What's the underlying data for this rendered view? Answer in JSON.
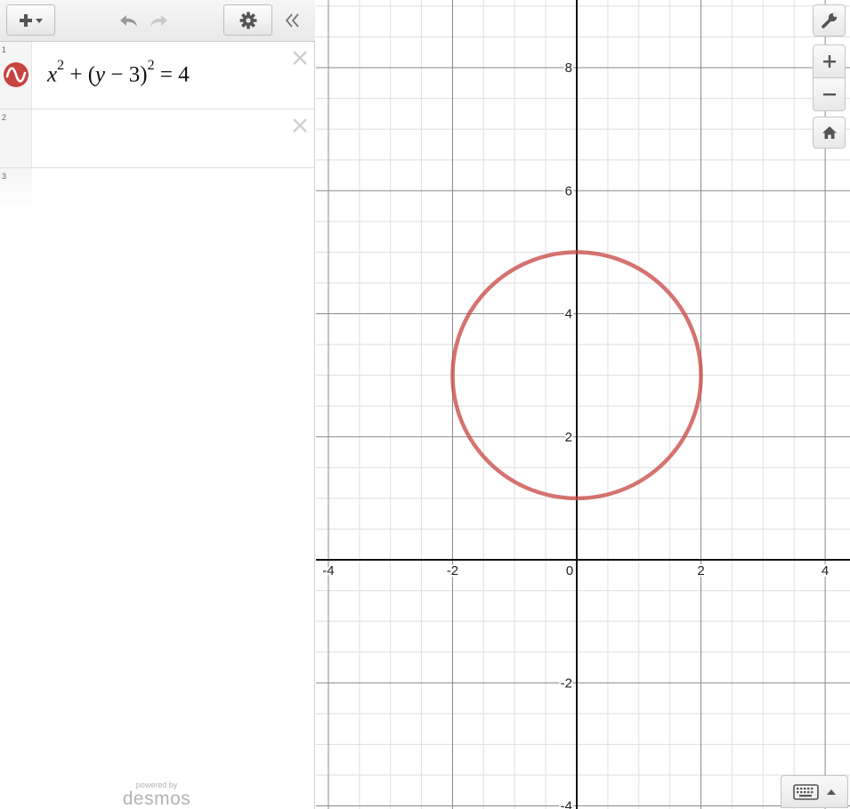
{
  "toolbar": {
    "add_icon": "plus-dropdown-icon",
    "undo_icon": "undo-icon",
    "redo_icon": "redo-icon",
    "settings_icon": "gear-icon",
    "collapse_icon": "double-chevron-left-icon"
  },
  "expressions": [
    {
      "number": "1",
      "latex": "x^2+(y-3)^2=4",
      "color": "#c74440",
      "icon": "graph-wave-icon"
    },
    {
      "number": "2",
      "latex": ""
    },
    {
      "number": "3",
      "latex": ""
    }
  ],
  "branding": {
    "powered_by": "powered by",
    "name": "desmos"
  },
  "graph": {
    "x_range": [
      -4.2,
      4.4
    ],
    "y_range": [
      -4.05,
      9.1
    ],
    "major_step": 2,
    "minor_step": 0.5,
    "grid": true,
    "x_tick_labels": [
      "-4",
      "-2",
      "0",
      "2",
      "4"
    ],
    "y_tick_labels": [
      "8",
      "6",
      "4",
      "2",
      "-2",
      "-4"
    ],
    "curve": {
      "type": "circle",
      "center": [
        0,
        3
      ],
      "radius": 2,
      "color": "#c74440"
    }
  },
  "controls": {
    "wrench_icon": "wrench-icon",
    "zoom_in_icon": "plus-icon",
    "zoom_out_icon": "minus-icon",
    "home_icon": "home-icon",
    "keyboard_icon": "keyboard-icon"
  }
}
